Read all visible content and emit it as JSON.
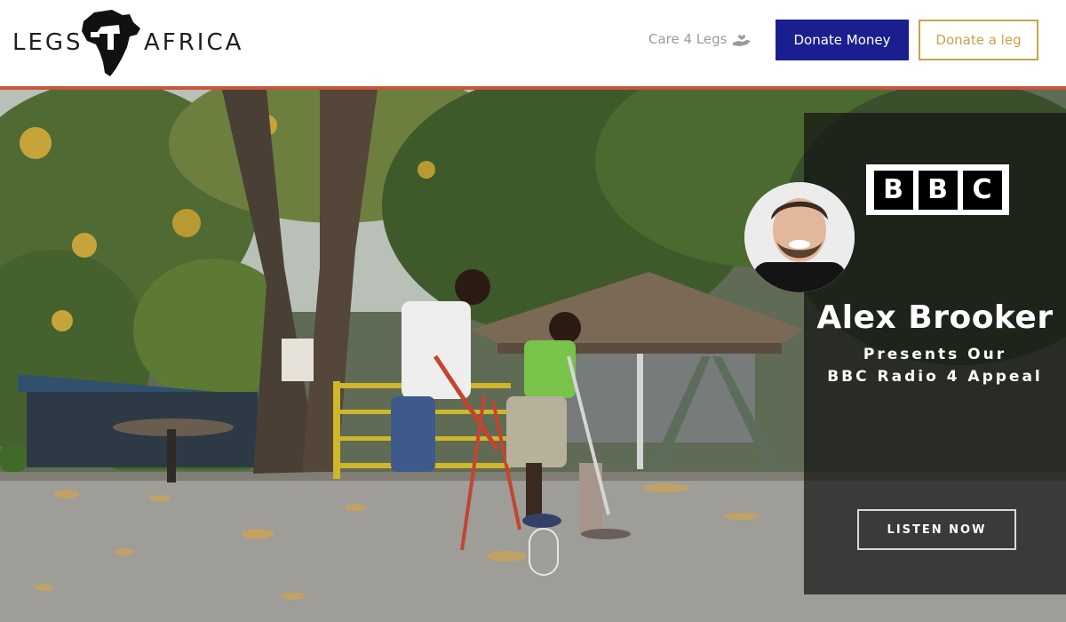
{
  "header": {
    "logo": {
      "left_word": "LEGS",
      "right_word": "AFRICA",
      "mark": "4",
      "map_icon": "africa-map-icon"
    },
    "care_link": {
      "label": "Care 4 Legs",
      "icon": "helping-hand-icon"
    },
    "donate_money_label": "Donate Money",
    "donate_leg_label": "Donate a leg",
    "colors": {
      "primary_button": "#1b1e8f",
      "outline_button": "#c9a24a",
      "rule": "#c8553a"
    }
  },
  "hero": {
    "caption": {
      "brand_letters": [
        "B",
        "B",
        "C"
      ],
      "presenter_name": "Alex Brooker",
      "presents_line": "Presents Our",
      "appeal_line": "BBC Radio 4 Appeal",
      "listen_label": "LISTEN NOW"
    },
    "scroll_icon": "scroll-mouse-icon"
  }
}
